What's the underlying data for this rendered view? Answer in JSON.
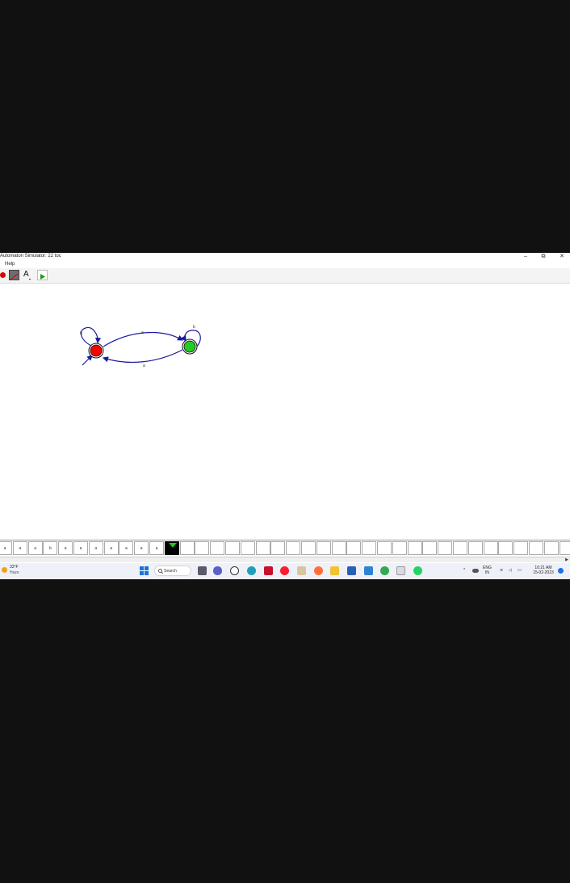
{
  "window": {
    "title": "Automaton Simulator: 22 toc",
    "minimize_label": "–",
    "restore_label": "⧉",
    "close_label": "✕"
  },
  "menu": {
    "help_label": "Help"
  },
  "toolbar": {
    "tools": [
      {
        "name": "state-tool",
        "icon": "red-dot-icon"
      },
      {
        "name": "transition-tool",
        "icon": "transition-icon"
      },
      {
        "name": "label-tool",
        "icon": "text-a-icon",
        "label": "A"
      },
      {
        "name": "run-tool",
        "icon": "play-icon"
      }
    ]
  },
  "automaton": {
    "states": [
      {
        "id": "q0",
        "start": true,
        "accepting": true,
        "color": "#ff0000"
      },
      {
        "id": "q1",
        "start": false,
        "accepting": true,
        "color": "#22cc22"
      }
    ],
    "transitions": [
      {
        "from": "q0",
        "to": "q0",
        "label": "b"
      },
      {
        "from": "q0",
        "to": "q1",
        "label": "a"
      },
      {
        "from": "q1",
        "to": "q1",
        "label": "b"
      },
      {
        "from": "q1",
        "to": "q0",
        "label": "a"
      }
    ],
    "edge_color": "#1a1aa0"
  },
  "tape": {
    "cells": [
      "a",
      "a",
      "a",
      "b",
      "a",
      "a",
      "a",
      "a",
      "a",
      "a",
      "a"
    ],
    "head_index": 11,
    "blank_cells": 26
  },
  "taskbar": {
    "weather": {
      "temp": "33°F",
      "condition": "Haze"
    },
    "search_label": "Search",
    "language": {
      "line1": "ENG",
      "line2": "IN"
    },
    "clock": {
      "time": "10:21 AM",
      "date": "15-02-2023"
    },
    "apps": [
      "windows-start",
      "search",
      "task-view",
      "chat",
      "dell",
      "edge",
      "mcafee",
      "opera",
      "store",
      "firefox",
      "file-explorer",
      "word",
      "notepad",
      "chrome",
      "installer",
      "whatsapp"
    ]
  }
}
